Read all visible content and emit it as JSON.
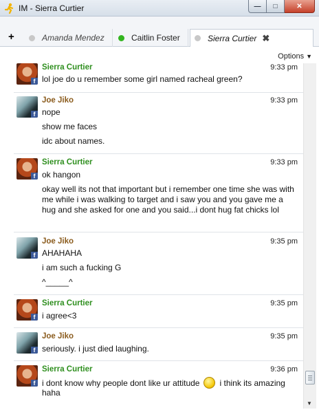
{
  "window": {
    "title": "IM - Sierra Curtier",
    "app_icon": "aim-running-man-icon",
    "minimize": "—",
    "maximize": "□",
    "close": "✕"
  },
  "tabs": {
    "add_label": "+",
    "items": [
      {
        "label": "Amanda Mendez",
        "status_color": "#c8c8c8"
      },
      {
        "label": "Caitlin Foster",
        "status_color": "#33b51f"
      },
      {
        "label": "Sierra Curtier",
        "status_color": "#c8c8c8",
        "close": "✖"
      }
    ]
  },
  "options": {
    "label": "Options"
  },
  "colors": {
    "sierra": "#2f8f1f",
    "joe": "#8a5b1c",
    "accent": "#3b5998"
  },
  "messages": [
    {
      "sender": "Sierra Curtier",
      "time": "9:33 pm",
      "lines": [
        "lol joe do u remember some girl named racheal green?"
      ]
    },
    {
      "sender": "Joe Jiko",
      "time": "9:33 pm",
      "lines": [
        "nope",
        "show me faces",
        "idc about names."
      ]
    },
    {
      "sender": "Sierra Curtier",
      "time": "9:33 pm",
      "lines": [
        "ok hangon",
        "okay well its not that important but i remember one time she was with me while i was walking to target and i saw you and you gave me a hug and she asked for one and you said...i dont hug fat chicks lol"
      ]
    },
    {
      "sender": "Joe Jiko",
      "time": "9:35 pm",
      "lines": [
        "AHAHAHA",
        "i am such a fucking G",
        "^_____^"
      ]
    },
    {
      "sender": "Sierra Curtier",
      "time": "9:35 pm",
      "lines": [
        "i agree<3"
      ]
    },
    {
      "sender": "Joe Jiko",
      "time": "9:35 pm",
      "lines": [
        "seriously. i just died laughing."
      ]
    },
    {
      "sender": "Sierra Curtier",
      "time": "9:36 pm",
      "lines": [
        "i dont know why people dont like ur attitude",
        "i think its amazing",
        "haha"
      ]
    }
  ],
  "badge": "f"
}
